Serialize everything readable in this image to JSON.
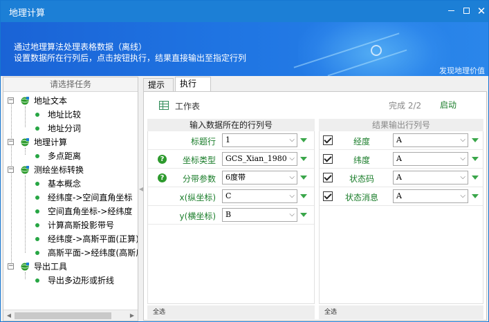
{
  "window": {
    "title": "地理计算"
  },
  "banner": {
    "line1": "通过地理算法处理表格数据（离线）",
    "line2": "设置数据所在行列后，点击按钮执行，结果直接输出至指定行列",
    "slogan": "发现地理价值"
  },
  "task_panel": {
    "header": "请选择任务",
    "tree": [
      {
        "label": "地址文本",
        "children": [
          "地址比较",
          "地址分词"
        ]
      },
      {
        "label": "地理计算",
        "children": [
          "多点距离"
        ]
      },
      {
        "label": "测绘坐标转换",
        "children": [
          "基本概念",
          "经纬度->空间直角坐标",
          "空间直角坐标->经纬度",
          "计算高斯投影带号",
          "经纬度->高斯平面(正算)",
          "高斯平面->经纬度(高斯反算)"
        ]
      },
      {
        "label": "导出工具",
        "children": [
          "导出多边形或折线"
        ]
      }
    ]
  },
  "tabs": [
    "提示",
    "执行"
  ],
  "toolbar": {
    "worksheet_label": "工作表",
    "progress": "完成 2/2",
    "start_label": "启动"
  },
  "input": {
    "header": "输入数据所在的行列号",
    "select_all": "全选",
    "rows": [
      {
        "label": "标题行",
        "value": "1",
        "help": false
      },
      {
        "label": "坐标类型",
        "value": "GCS_Xian_1980",
        "help": true
      },
      {
        "label": "分带参数",
        "value": "6度带",
        "help": true
      },
      {
        "label": "x(纵坐标)",
        "value": "C",
        "help": false
      },
      {
        "label": "y(横坐标)",
        "value": "B",
        "help": false
      }
    ]
  },
  "output": {
    "header": "结果输出行列号",
    "select_all": "全选",
    "rows": [
      {
        "label": "经度",
        "value": "A",
        "checked": true
      },
      {
        "label": "纬度",
        "value": "A",
        "checked": true
      },
      {
        "label": "状态码",
        "value": "A",
        "checked": true
      },
      {
        "label": "状态消息",
        "value": "A",
        "checked": true
      }
    ]
  },
  "colors": {
    "titlebar": "#1c7fd6",
    "accent_green": "#1a7d2a",
    "help_green": "#2d9a2d"
  }
}
